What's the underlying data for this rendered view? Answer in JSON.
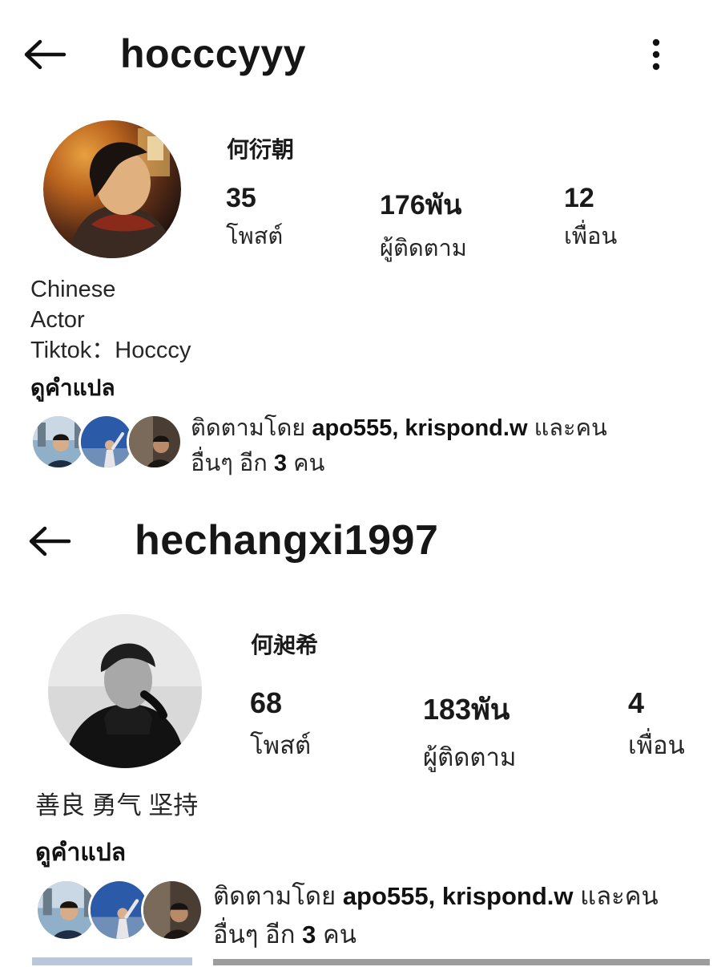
{
  "profiles": [
    {
      "username": "hocccyyy",
      "full_name": "何衍朝",
      "stats": [
        {
          "value": "35",
          "label": "โพสต์"
        },
        {
          "value": "176พัน",
          "label": "ผู้ติดตาม"
        },
        {
          "value": "12",
          "label": "เพื่อน"
        }
      ],
      "bio": [
        "Chinese",
        "Actor",
        "Tiktok：Hocccy"
      ],
      "translate_label": "ดูคำแปล",
      "mutual": {
        "prefix": "ติดตามโดย",
        "names": "apo555, krispond.w",
        "suffix": "และคน",
        "line2_prefix": "อื่นๆ อีก",
        "count": "3",
        "line2_suffix": "คน"
      }
    },
    {
      "username": "hechangxi1997",
      "full_name": "何昶希",
      "stats": [
        {
          "value": "68",
          "label": "โพสต์"
        },
        {
          "value": "183พัน",
          "label": "ผู้ติดตาม"
        },
        {
          "value": "4",
          "label": "เพื่อน"
        }
      ],
      "bio": [
        "善良 勇气 坚持"
      ],
      "translate_label": "ดูคำแปล",
      "mutual": {
        "prefix": "ติดตามโดย",
        "names": "apo555, krispond.w",
        "suffix": "และคน",
        "line2_prefix": "อื่นๆ อีก",
        "count": "3",
        "line2_suffix": "คน"
      }
    }
  ],
  "icons": {
    "back": "back-arrow-icon",
    "more": "more-vertical-icon"
  },
  "colors": {
    "text": "#111111",
    "secondary": "#262626",
    "background": "#ffffff"
  }
}
